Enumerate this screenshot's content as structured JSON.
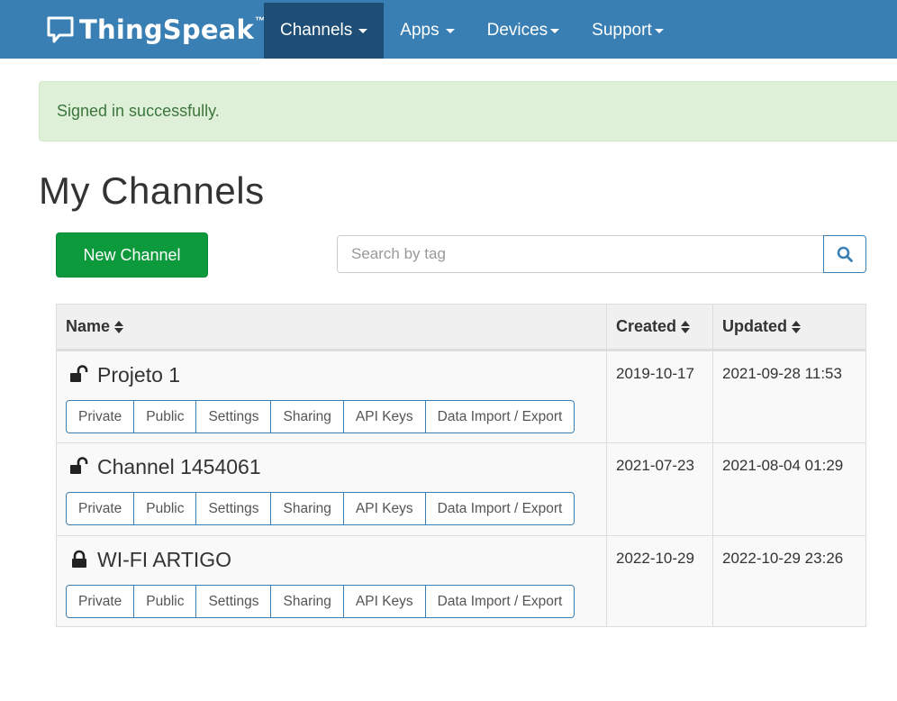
{
  "navbar": {
    "brand": "ThingSpeak",
    "brand_tm": "™",
    "items": [
      {
        "label": "Channels",
        "active": true
      },
      {
        "label": "Apps",
        "active": false
      },
      {
        "label": "Devices",
        "active": false
      },
      {
        "label": "Support",
        "active": false
      }
    ]
  },
  "alert": {
    "message": "Signed in successfully."
  },
  "page": {
    "title": "My Channels"
  },
  "toolbar": {
    "new_channel_label": "New Channel"
  },
  "search": {
    "placeholder": "Search by tag",
    "value": "",
    "icon": "search-icon"
  },
  "table": {
    "headers": {
      "name": "Name",
      "created": "Created",
      "updated": "Updated"
    },
    "rows": [
      {
        "name": "Projeto 1",
        "access_icon": "unlock-icon",
        "created": "2019-10-17",
        "updated": "2021-09-28 11:53",
        "actions": [
          "Private",
          "Public",
          "Settings",
          "Sharing",
          "API Keys",
          "Data Import / Export"
        ]
      },
      {
        "name": "Channel 1454061",
        "access_icon": "unlock-icon",
        "created": "2021-07-23",
        "updated": "2021-08-04 01:29",
        "actions": [
          "Private",
          "Public",
          "Settings",
          "Sharing",
          "API Keys",
          "Data Import / Export"
        ]
      },
      {
        "name": "WI-FI ARTIGO",
        "access_icon": "lock-icon",
        "created": "2022-10-29",
        "updated": "2022-10-29 23:26",
        "actions": [
          "Private",
          "Public",
          "Settings",
          "Sharing",
          "API Keys",
          "Data Import / Export"
        ]
      }
    ]
  },
  "colors": {
    "navbar": "#3a7fb3",
    "nav_active": "#1e4e75",
    "alert_bg": "#dff0d8",
    "alert_text": "#3c763d",
    "primary_green": "#0d9a3c"
  }
}
